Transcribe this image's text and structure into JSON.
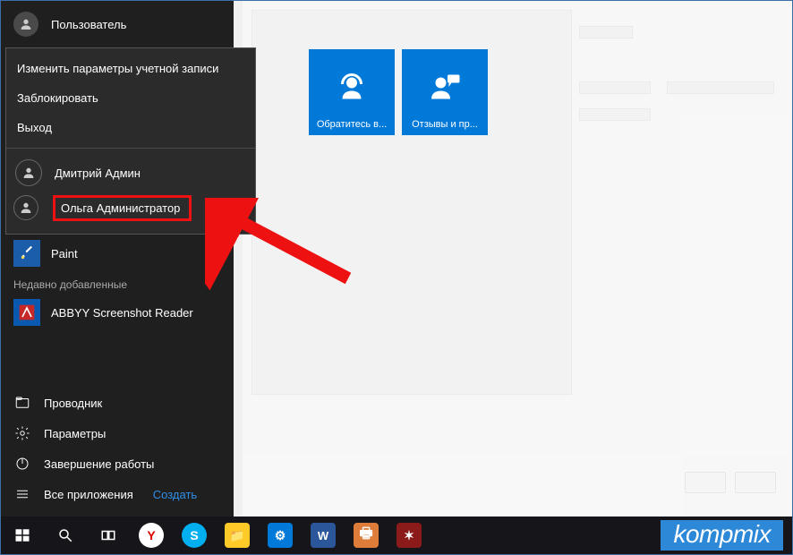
{
  "user": {
    "name": "Пользователь"
  },
  "flyout": {
    "change_account": "Изменить параметры учетной записи",
    "lock": "Заблокировать",
    "signout": "Выход",
    "users": [
      {
        "name": "Дмитрий Админ"
      },
      {
        "name": "Ольга Администратор"
      }
    ]
  },
  "apps": {
    "paint": "Paint",
    "recently_added": "Недавно добавленные",
    "abbyy": "ABBYY Screenshot Reader"
  },
  "system": {
    "explorer": "Проводник",
    "settings": "Параметры",
    "power": "Завершение работы",
    "all_apps": "Все приложения",
    "create": "Создать"
  },
  "tiles": [
    {
      "label": "Обратитесь в..."
    },
    {
      "label": "Отзывы и пр..."
    }
  ],
  "watermark": "kompmix"
}
